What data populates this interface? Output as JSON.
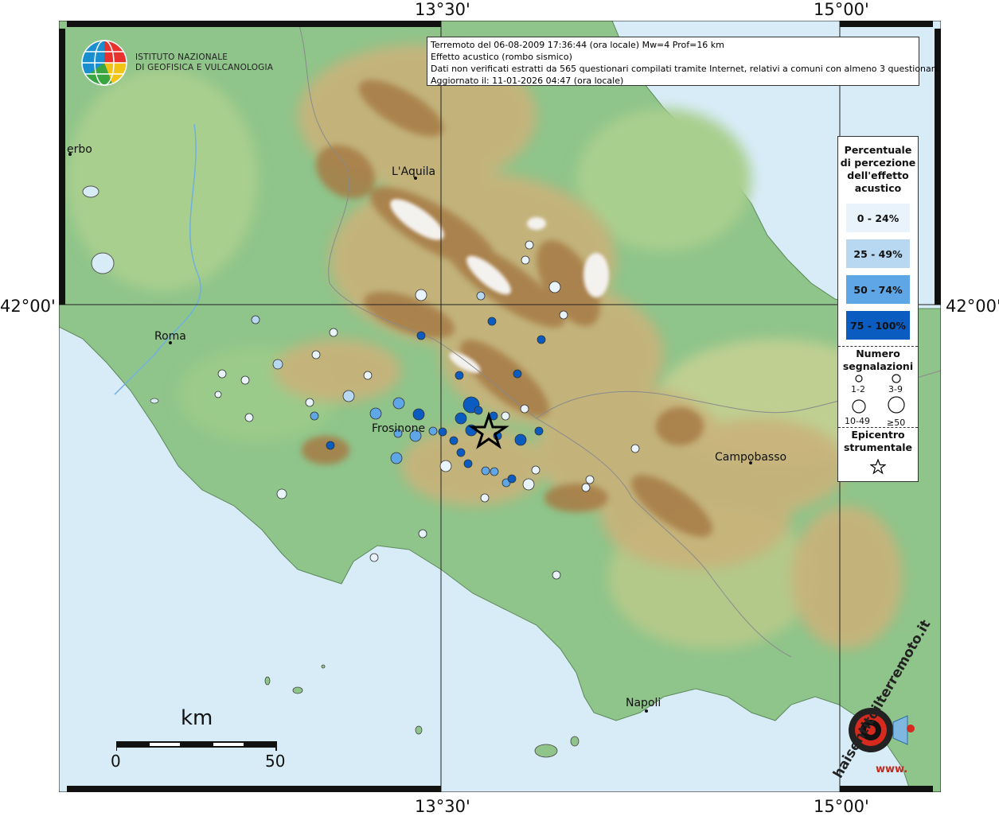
{
  "header": {
    "institute_line1": "ISTITUTO NAZIONALE",
    "institute_line2": "DI GEOFISICA E VULCANOLOGIA"
  },
  "info": {
    "line1": "Terremoto del 06-08-2009 17:36:44 (ora locale) Mw=4 Prof=16 km",
    "line2": "Effetto acustico (rombo sismico)",
    "line3": "Dati non verificati estratti da 565 questionari compilati tramite Internet, relativi a comuni con almeno 3 questionari.",
    "line4": "Aggiornato il: 11-01-2026 04:47 (ora locale)"
  },
  "axes": {
    "top_left": "13°30'",
    "top_right": "15°00'",
    "bottom_left": "13°30'",
    "bottom_right": "15°00'",
    "left": "42°00'",
    "right": "42°00'"
  },
  "places": {
    "laquila": "L'Aquila",
    "roma": "Roma",
    "frosinone": "Frosinone",
    "campobasso": "Campobasso",
    "napoli": "Napoli",
    "viterbo": "erbo"
  },
  "legend": {
    "title": [
      "Percentuale",
      "di percezione",
      "dell'effetto",
      "acustico"
    ],
    "classes": [
      {
        "label": "0 - 24%",
        "color": "#e8f3fb"
      },
      {
        "label": "25 - 49%",
        "color": "#b8d8f2"
      },
      {
        "label": "50 - 74%",
        "color": "#5ea6e6"
      },
      {
        "label": "75 - 100%",
        "color": "#0a5cc0"
      }
    ],
    "count_title": [
      "Numero",
      "segnalazioni"
    ],
    "count_classes": [
      "1-2",
      "3-9",
      "10-49",
      "≥50"
    ],
    "epicenter_title": [
      "Epicentro",
      "strumentale"
    ]
  },
  "scale": {
    "unit": "km",
    "min": "0",
    "max": "50"
  },
  "brand": {
    "text": "haisentitoilterremoto.it",
    "url": "www."
  },
  "colors": {
    "sea": "#d7ecf7",
    "lowland": "#8fc48a",
    "hills": "#c9b27a",
    "mountain": "#a67a45",
    "peaks": "#f2f2f2"
  }
}
